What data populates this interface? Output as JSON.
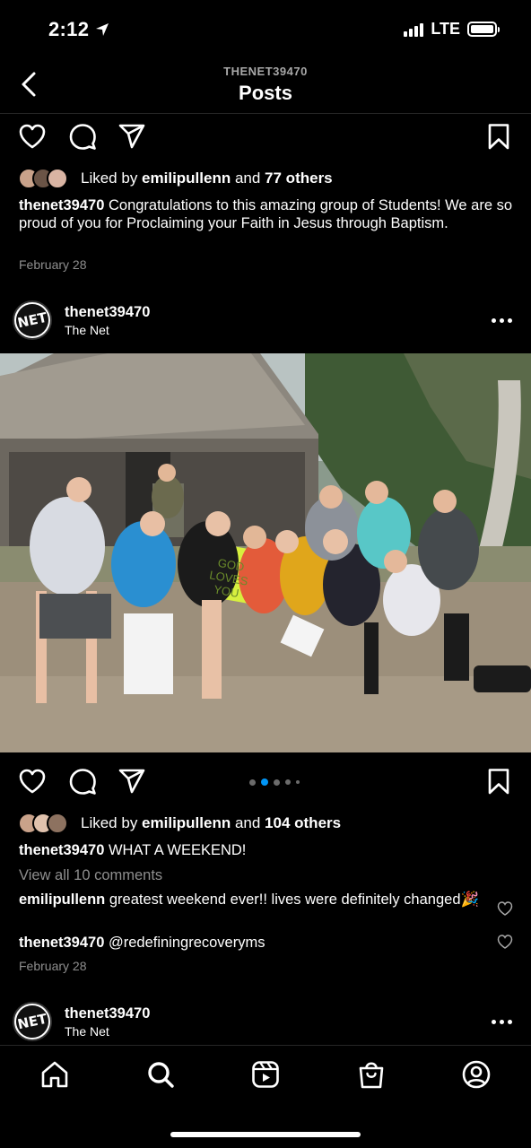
{
  "status": {
    "time": "2:12",
    "network": "LTE"
  },
  "header": {
    "username": "THENET39470",
    "title": "Posts"
  },
  "post1": {
    "likes_prefix": "Liked by ",
    "likes_user": "emilipullenn",
    "likes_suffix": " and ",
    "likes_others": "77 others",
    "caption_user": "thenet39470",
    "caption_text": " Congratulations to this amazing group of Students! We are so proud of you for Proclaiming your Faith in Jesus through Baptism.",
    "date": "February 28"
  },
  "post2": {
    "username": "thenet39470",
    "subtitle": "The Net",
    "sign_text": "GOD LOVES YOU",
    "carousel_active_index": 1,
    "likes_prefix": "Liked by ",
    "likes_user": "emilipullenn",
    "likes_suffix": " and ",
    "likes_others": "104 others",
    "caption_user": "thenet39470",
    "caption_text": " WHAT A WEEKEND!",
    "view_comments": "View all 10 comments",
    "comments": [
      {
        "user": "emilipullenn",
        "text": " greatest weekend ever!! lives were definitely changed",
        "emoji": "🎉"
      },
      {
        "user": "thenet39470",
        "text": " @redefiningrecoveryms"
      }
    ],
    "date": "February 28"
  },
  "post3": {
    "username": "thenet39470",
    "subtitle": "The Net"
  },
  "logo_text": "NET",
  "colors": {
    "background": "#000000",
    "secondary_text": "#8e8e8e",
    "accent_dot": "#0095f6"
  },
  "nav": [
    "home-icon",
    "search-icon",
    "reels-icon",
    "shop-icon",
    "profile-icon"
  ]
}
